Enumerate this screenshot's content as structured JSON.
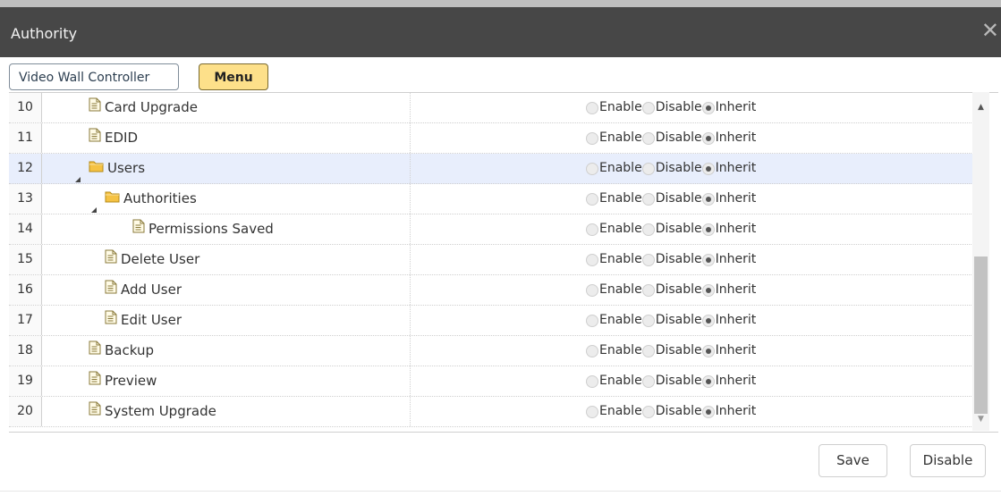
{
  "dialog": {
    "title": "Authority",
    "close_glyph": "✕"
  },
  "tabs": [
    {
      "label": "Video Wall Controller",
      "active": false
    },
    {
      "label": "Menu",
      "active": true
    }
  ],
  "rows": [
    {
      "num": "10",
      "name": "Card Upgrade",
      "type": "file",
      "level": 1,
      "selected": false,
      "value": "Inherit"
    },
    {
      "num": "11",
      "name": "EDID",
      "type": "file",
      "level": 1,
      "selected": false,
      "value": "Inherit"
    },
    {
      "num": "12",
      "name": "Users",
      "type": "folder",
      "level": 1,
      "expanded": true,
      "selected": true,
      "value": "Inherit"
    },
    {
      "num": "13",
      "name": "Authorities",
      "type": "folder",
      "level": 2,
      "expanded": true,
      "selected": false,
      "value": "Inherit"
    },
    {
      "num": "14",
      "name": "Permissions Saved",
      "type": "file",
      "level": 3,
      "selected": false,
      "value": "Inherit"
    },
    {
      "num": "15",
      "name": "Delete User",
      "type": "file",
      "level": 2,
      "selected": false,
      "value": "Inherit"
    },
    {
      "num": "16",
      "name": "Add User",
      "type": "file",
      "level": 2,
      "selected": false,
      "value": "Inherit"
    },
    {
      "num": "17",
      "name": "Edit User",
      "type": "file",
      "level": 2,
      "selected": false,
      "value": "Inherit"
    },
    {
      "num": "18",
      "name": "Backup",
      "type": "file",
      "level": 1,
      "selected": false,
      "value": "Inherit"
    },
    {
      "num": "19",
      "name": "Preview",
      "type": "file",
      "level": 1,
      "selected": false,
      "value": "Inherit"
    },
    {
      "num": "20",
      "name": "System Upgrade",
      "type": "file",
      "level": 1,
      "selected": false,
      "value": "Inherit"
    }
  ],
  "options": [
    "Enable",
    "Disable",
    "Inherit"
  ],
  "buttons": {
    "save": "Save",
    "disable": "Disable"
  },
  "colors": {
    "titlebar": "#474747",
    "active_tab": "#fde08a",
    "selected_row": "#e8eefc",
    "folder": "#f5c243"
  },
  "icons": {
    "file": "file-icon",
    "folder": "folder-icon",
    "expand": "expanded-arrow-icon",
    "close": "close-icon"
  }
}
